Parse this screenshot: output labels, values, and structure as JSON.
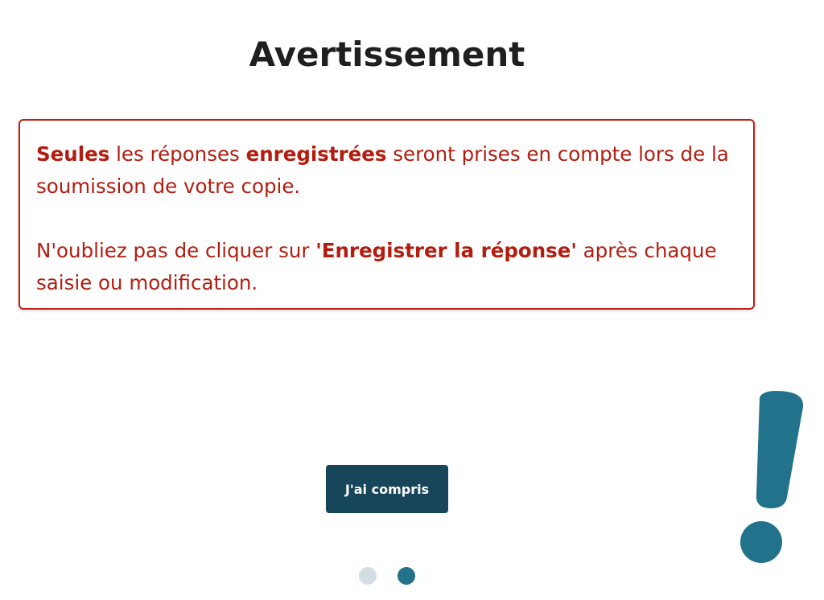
{
  "modal": {
    "title": "Avertissement",
    "warning": {
      "p1": {
        "s1": "Seules",
        "t1": " les réponses ",
        "s2": "enregistrées",
        "t2": " seront prises en compte lors de la soumission de votre copie."
      },
      "p2": {
        "t1": "N'oubliez pas de cliquer sur ",
        "s1": "'Enregistrer la réponse'",
        "t2": " après chaque saisie ou modification."
      }
    },
    "confirm_label": "J'ai compris",
    "pagination": {
      "total": 2,
      "active": 2
    },
    "illustration": "exclamation-icon"
  },
  "colors": {
    "warning_text": "#b31d10",
    "warning_border": "#c02011",
    "button_bg": "#17465a",
    "accent": "#23728c",
    "dot_inactive": "#d3dee4"
  }
}
